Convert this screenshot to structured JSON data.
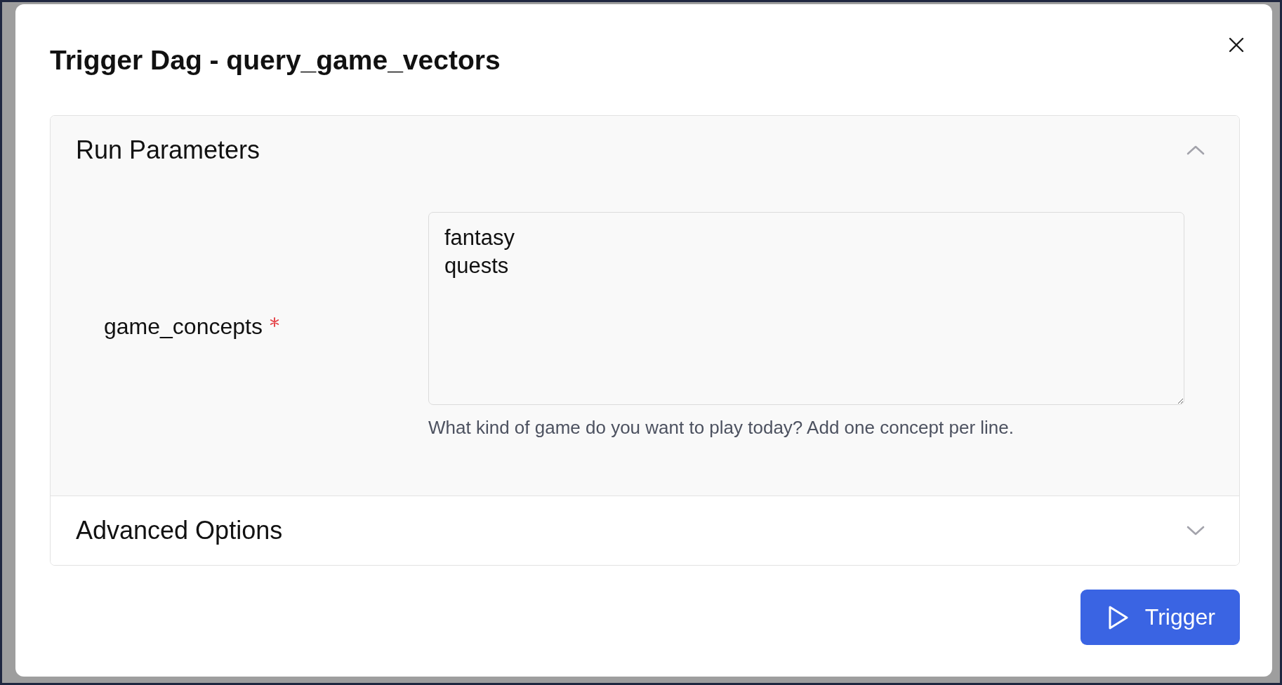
{
  "dialog": {
    "title": "Trigger Dag - query_game_vectors"
  },
  "sections": [
    {
      "title": "Run Parameters",
      "expanded": true,
      "fields": [
        {
          "label": "game_concepts",
          "required": true,
          "value": "fantasy\nquests",
          "help": "What kind of game do you want to play today? Add one concept per line."
        }
      ]
    },
    {
      "title": "Advanced Options",
      "expanded": false
    }
  ],
  "actions": [
    {
      "label": "Trigger"
    }
  ]
}
